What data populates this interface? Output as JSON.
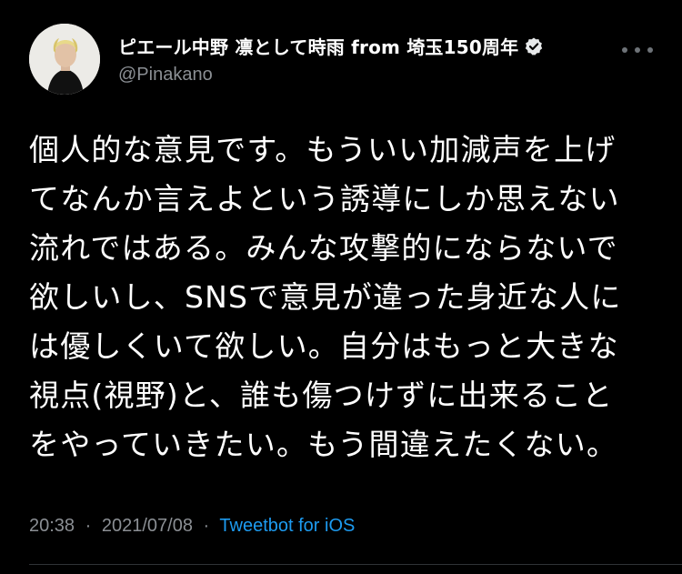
{
  "header": {
    "display_name": "ピエール中野 凛として時雨 from 埼玉150周年",
    "handle": "@Pinakano",
    "verified_icon": "verified-badge-icon",
    "more_icon": "more-horizontal-icon"
  },
  "tweet": {
    "lines": [
      "個人的な意見です。もういい加減声を上げ",
      "てなんか言えよという誘導にしか思えない",
      "流れではある。みんな攻撃的にならないで",
      "欲しいし、SNSで意見が違った身近な人に",
      "は優しくいて欲しい。自分はもっと大きな",
      "視点(視野)と、誰も傷つけずに出来ること",
      "をやっていきたい。もう間違えたくない。"
    ]
  },
  "meta": {
    "time": "20:38",
    "separator": "·",
    "date": "2021/07/08",
    "client": "Tweetbot for iOS"
  },
  "colors": {
    "background": "#000000",
    "text": "#ffffff",
    "secondary": "#8b8f94",
    "link": "#1d9bf0"
  }
}
